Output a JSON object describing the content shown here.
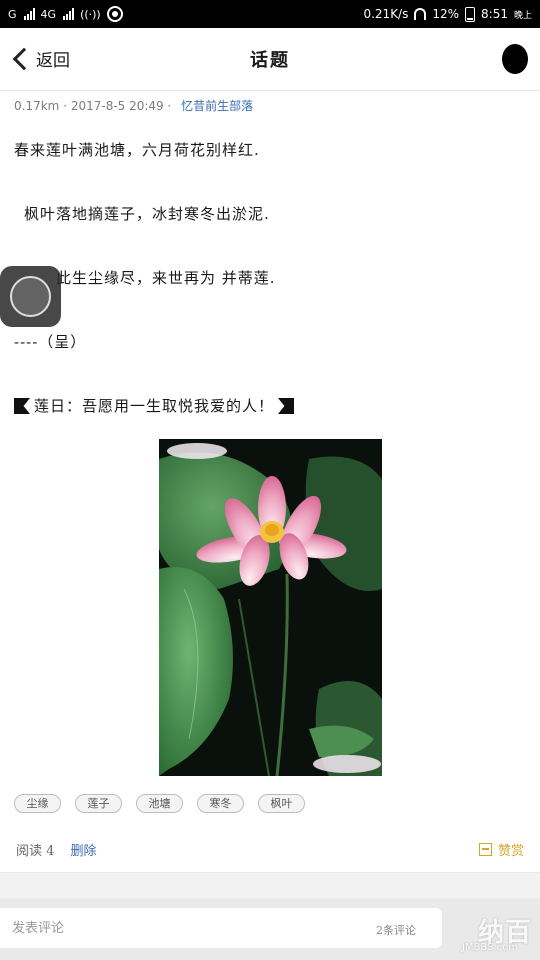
{
  "status_bar": {
    "carrier1": "G",
    "carrier2": "4G",
    "carrier2_sup": "4G",
    "speed": "0.21K/s",
    "battery": "12%",
    "time": "8:51",
    "period": "晚上"
  },
  "header": {
    "back_label": "返回",
    "title": "话题",
    "more_icon": "more-dot-icon"
  },
  "post": {
    "distance": "0.17km",
    "datetime": "2017-8-5 20:49",
    "author": "忆昔前生部落",
    "lines": [
      "春来莲叶满池塘，六月荷花别样红.",
      "枫叶落地摘莲子，冰封寒冬出淤泥.",
      "此生尘缘尽，来世再为 并蒂莲.",
      "----（呈）"
    ],
    "highlight": "莲日：吾愿用一生取悦我爱的人！",
    "image_alt": "粉色荷花"
  },
  "tags": [
    "尘缘",
    "莲子",
    "池塘",
    "寒冬",
    "枫叶"
  ],
  "stats": {
    "reads_label": "阅读",
    "reads": "4",
    "delete_label": "删除",
    "reward_label": "赞赏"
  },
  "comment": {
    "placeholder": "发表评论",
    "count": "2条评论"
  },
  "watermark": {
    "text": "纳百",
    "site": "JMBBS.com"
  }
}
